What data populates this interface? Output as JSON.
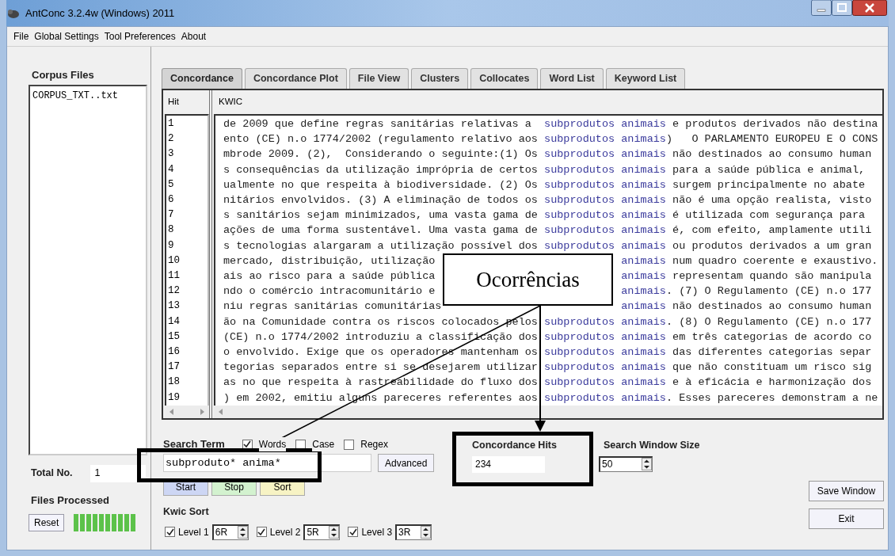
{
  "window": {
    "title": "AntConc 3.2.4w (Windows) 2011"
  },
  "menu": [
    "File",
    "Global Settings",
    "Tool Preferences",
    "About"
  ],
  "corpus_files": {
    "label": "Corpus Files",
    "files": [
      "CORPUS_TXT..txt"
    ]
  },
  "total_no": {
    "label": "Total No.",
    "value": "1"
  },
  "files_processed": {
    "label": "Files Processed",
    "reset": "Reset",
    "level": 1
  },
  "tabs": [
    {
      "label": "Concordance",
      "selected": true
    },
    {
      "label": "Concordance Plot",
      "selected": false
    },
    {
      "label": "File View",
      "selected": false
    },
    {
      "label": "Clusters",
      "selected": false
    },
    {
      "label": "Collocates",
      "selected": false
    },
    {
      "label": "Word List",
      "selected": false
    },
    {
      "label": "Keyword List",
      "selected": false
    }
  ],
  "table": {
    "columns": [
      "Hit",
      "KWIC"
    ],
    "rows": [
      {
        "hit": "1",
        "left": "de 2009 que define regras sanitárias relativas a",
        "keyword": "subprodutos animais",
        "right": " e produtos derivados não destina"
      },
      {
        "hit": "2",
        "left": "ento (CE) n.o 1774/2002 (regulamento relativo aos",
        "keyword": "subprodutos animais",
        "right": ")   O PARLAMENTO EUROPEU E O CONS"
      },
      {
        "hit": "3",
        "left": "mbrode 2009. (2),  Considerando o seguinte:(1) Os",
        "keyword": "subprodutos animais",
        "right": " não destinados ao consumo human"
      },
      {
        "hit": "4",
        "left": "s consequências da utilização imprópria de certos",
        "keyword": "subprodutos animais",
        "right": " para a saúde pública e animal,"
      },
      {
        "hit": "5",
        "left": "ualmente no que respeita à biodiversidade. (2) Os",
        "keyword": "subprodutos animais",
        "right": " surgem principalmente no abate"
      },
      {
        "hit": "6",
        "left": "nitários envolvidos. (3) A eliminação de todos os",
        "keyword": "subprodutos animais",
        "right": " não é uma opção realista, visto"
      },
      {
        "hit": "7",
        "left": "s sanitários sejam minimizados, uma vasta gama de",
        "keyword": "subprodutos animais",
        "right": " é utilizada com segurança para"
      },
      {
        "hit": "8",
        "left": "ações de uma forma sustentável. Uma vasta gama de",
        "keyword": "subprodutos animais",
        "right": " é, com efeito, amplamente utili"
      },
      {
        "hit": "9",
        "left": "s tecnologias alargaram a utilização possível dos",
        "keyword": "subprodutos animais",
        "right": " ou produtos derivados a um gran"
      },
      {
        "hit": "10",
        "left": "mercado, distribuição, utilização",
        "keyword": "animais",
        "right": " num quadro coerente e exaustivo."
      },
      {
        "hit": "11",
        "left": "ais ao risco para a saúde pública",
        "keyword": "animais",
        "right": " representam quando são manipula"
      },
      {
        "hit": "12",
        "left": "ndo o comércio intracomunitário e",
        "keyword": "animais",
        "right": ". (7) O Regulamento (CE) n.o 177"
      },
      {
        "hit": "13",
        "left": "niu regras sanitárias comunitárias",
        "keyword": "animais",
        "right": " não destinados ao consumo human"
      },
      {
        "hit": "14",
        "left": "ão na Comunidade contra os riscos colocados pelos",
        "keyword": "subprodutos animais",
        "right": ". (8) O Regulamento (CE) n.o 177"
      },
      {
        "hit": "15",
        "left": "(CE) n.o 1774/2002 introduziu a classificação dos",
        "keyword": "subprodutos animais",
        "right": " em três categorias de acordo co"
      },
      {
        "hit": "16",
        "left": "o envolvido. Exige que os operadores mantenham os",
        "keyword": "subprodutos animais",
        "right": " das diferentes categorias separ"
      },
      {
        "hit": "17",
        "left": "tegorias separados entre si se desejarem utilizar",
        "keyword": "subprodutos animais",
        "right": " que não constituam um risco sig"
      },
      {
        "hit": "18",
        "left": "as no que respeita à rastreabilidade do fluxo dos",
        "keyword": "subprodutos animais",
        "right": " e à eficácia e harmonização dos"
      },
      {
        "hit": "19",
        "left": ") em 2002, emitiu alguns pareceres referentes aos",
        "keyword": "subprodutos animais",
        "right": ". Esses pareceres demonstram a ne"
      }
    ]
  },
  "search": {
    "label": "Search Term",
    "options": [
      {
        "label": "Words",
        "checked": true
      },
      {
        "label": "Case",
        "checked": false
      },
      {
        "label": "Regex",
        "checked": false
      }
    ],
    "value": "subproduto* anima*",
    "advanced": "Advanced",
    "buttons": [
      {
        "label": "Start",
        "color": "#cdd6f4"
      },
      {
        "label": "Stop",
        "color": "#d3f2cf"
      },
      {
        "label": "Sort",
        "color": "#f7f3c4"
      }
    ]
  },
  "hits": {
    "label": "Concordance Hits",
    "value": "234"
  },
  "window_size": {
    "label": "Search Window Size",
    "value": "50"
  },
  "kwic_sort": {
    "label": "Kwic Sort",
    "levels": [
      {
        "label": "Level 1",
        "checked": true,
        "value": "6R"
      },
      {
        "label": "Level 2",
        "checked": true,
        "value": "5R"
      },
      {
        "label": "Level 3",
        "checked": true,
        "value": "3R"
      }
    ]
  },
  "buttons": [
    "Save Window",
    "Exit"
  ],
  "annotation": {
    "text": "Ocorrências"
  }
}
